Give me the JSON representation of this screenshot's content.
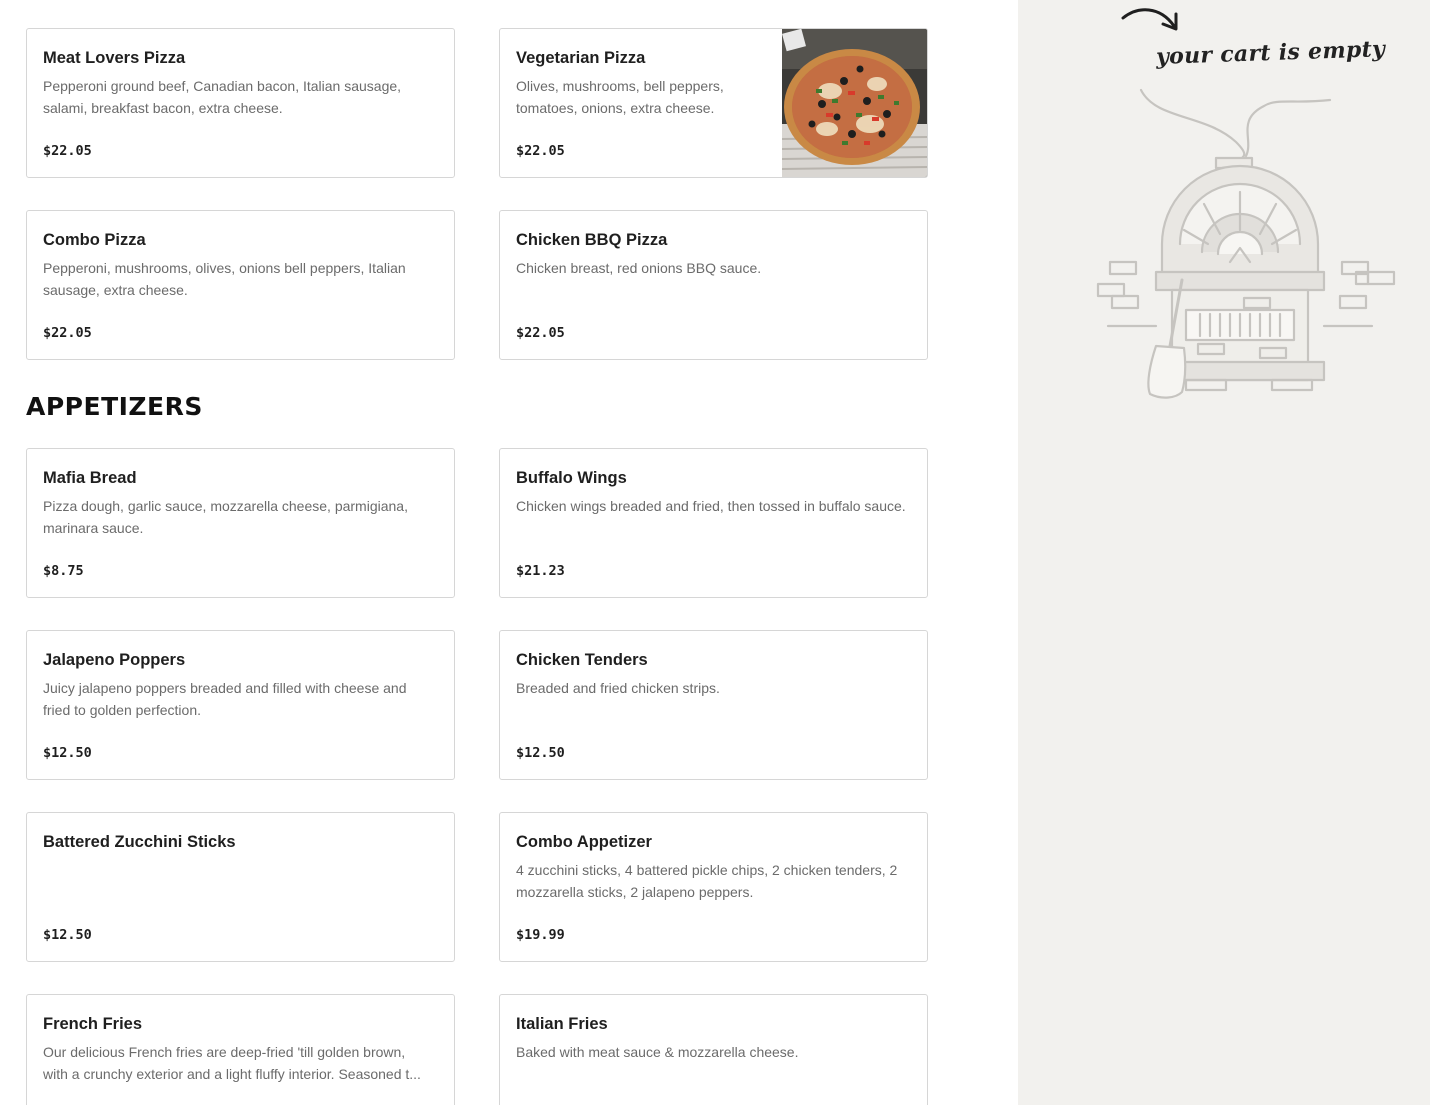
{
  "menu": {
    "pizza_items": [
      {
        "name": "Meat Lovers Pizza",
        "description": "Pepperoni ground beef, Canadian bacon, Italian sausage, salami, breakfast bacon, extra cheese.",
        "price": "$22.05"
      },
      {
        "name": "Vegetarian Pizza",
        "description": "Olives, mushrooms, bell peppers, tomatoes, onions, extra cheese.",
        "price": "$22.05"
      },
      {
        "name": "Combo Pizza",
        "description": "Pepperoni, mushrooms, olives, onions bell peppers, Italian sausage, extra cheese.",
        "price": "$22.05"
      },
      {
        "name": "Chicken BBQ Pizza",
        "description": "Chicken breast, red onions BBQ sauce.",
        "price": "$22.05"
      }
    ],
    "appetizers_title": "APPETIZERS",
    "appetizer_items": [
      {
        "name": "Mafia Bread",
        "description": "Pizza dough, garlic sauce, mozzarella cheese, parmigiana, marinara sauce.",
        "price": "$8.75"
      },
      {
        "name": "Buffalo Wings",
        "description": "Chicken wings breaded and fried, then tossed in buffalo sauce.",
        "price": "$21.23"
      },
      {
        "name": "Jalapeno Poppers",
        "description": "Juicy jalapeno poppers breaded and filled with cheese and fried to golden perfection.",
        "price": "$12.50"
      },
      {
        "name": "Chicken Tenders",
        "description": "Breaded and fried chicken strips.",
        "price": "$12.50"
      },
      {
        "name": "Battered Zucchini Sticks",
        "description": "",
        "price": "$12.50"
      },
      {
        "name": "Combo Appetizer",
        "description": "4 zucchini sticks, 4 battered pickle chips, 2 chicken tenders, 2 mozzarella sticks, 2 jalapeno peppers.",
        "price": "$19.99"
      },
      {
        "name": "French Fries",
        "description_line1": "Our delicious French fries are deep-fried 'till golden brown,",
        "description_line2": "with a crunchy exterior and a light fluffy interior. Seasoned t...",
        "price": ""
      },
      {
        "name": "Italian Fries",
        "description": "Baked with meat sauce & mozzarella cheese.",
        "price": ""
      }
    ]
  },
  "cart": {
    "empty_message": "your cart is empty",
    "illustration_icon": "pizza-oven-icon",
    "pointer_icon": "curved-arrow-icon"
  },
  "colors": {
    "page_background": "#ffffff",
    "cart_background": "#f2f1ee",
    "card_border": "#d6d6d6",
    "text_primary": "#1f1f1f",
    "text_secondary": "#6b6b6b"
  }
}
